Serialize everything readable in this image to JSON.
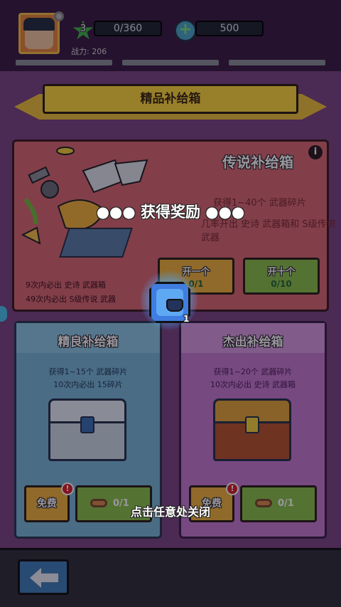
{
  "header": {
    "level": "3",
    "xp": "0/360",
    "gems": "500",
    "power": "战力: 206",
    "progress_bars": 3
  },
  "banner": {
    "title": "精品补给箱"
  },
  "legendary": {
    "title": "传说补给箱",
    "desc1": "获得1~40个 武器碎片",
    "desc2": "几率开出 史诗 武器箱和 S级传说 武器",
    "note1": "9次内必出 史诗 武器箱",
    "note2": "49次内必出 S级传说 武器",
    "open_one_label": "开一个",
    "open_one_count": "0/1",
    "open_ten_label": "开十个",
    "open_ten_count": "0/10"
  },
  "fine": {
    "title": "精良补给箱",
    "desc1": "获得1~15个 武器碎片",
    "desc2": "10次内必出 15碎片",
    "free_label": "免费",
    "key_count": "0/1"
  },
  "excellent": {
    "title": "杰出补给箱",
    "desc1": "获得1~20个 武器碎片",
    "desc2": "10次内必出 史诗 武器箱",
    "free_label": "免费",
    "key_count": "0/1"
  },
  "reward": {
    "title": "●●● 获得奖励 ●●●",
    "item_icon": "pot-icon",
    "item_count": "1",
    "close_hint": "点击任意处关闭"
  },
  "colors": {
    "legendary_panel": "#d96a72",
    "fine_panel": "#79b7d8",
    "excellent_panel": "#c77bd0",
    "banner": "#ffd93d",
    "green_button": "#8bc34a",
    "orange_button": "#f1b43b"
  }
}
